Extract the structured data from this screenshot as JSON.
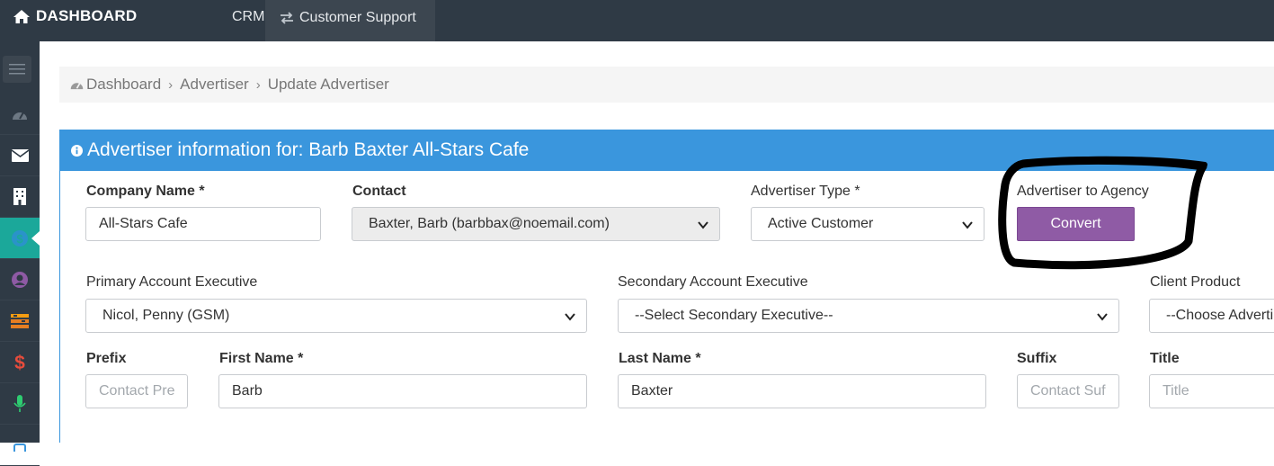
{
  "topbar": {
    "brand": "DASHBOARD",
    "nav_crm": "CRM",
    "nav_support": "Customer Support"
  },
  "sidebar": {
    "items": [
      "toggle-menu",
      "dashboard",
      "mail",
      "building",
      "dollar-circle",
      "user",
      "stack",
      "dollar",
      "microphone"
    ]
  },
  "breadcrumb": {
    "items": [
      "Dashboard",
      "Advertiser",
      "Update Advertiser"
    ]
  },
  "panel": {
    "title": "Advertiser information for: Barb Baxter All-Stars Cafe"
  },
  "form": {
    "company_name": {
      "label": "Company Name *",
      "value": "All-Stars Cafe"
    },
    "contact": {
      "label": "Contact",
      "value": "Baxter, Barb (barbbax@noemail.com)"
    },
    "advertiser_type": {
      "label": "Advertiser Type *",
      "value": "Active Customer"
    },
    "advertiser_to_agency": {
      "label": "Advertiser to Agency",
      "button": "Convert"
    },
    "primary_ae": {
      "label": "Primary Account Executive",
      "value": "Nicol, Penny (GSM)"
    },
    "secondary_ae": {
      "label": "Secondary Account Executive",
      "value": "--Select Secondary Executive--"
    },
    "client_product": {
      "label": "Client Product",
      "value": "--Choose Adverti"
    },
    "prefix": {
      "label": "Prefix",
      "placeholder": "Contact Pre"
    },
    "first_name": {
      "label": "First Name *",
      "value": "Barb"
    },
    "last_name": {
      "label": "Last Name *",
      "value": "Baxter"
    },
    "suffix": {
      "label": "Suffix",
      "placeholder": "Contact Suf"
    },
    "title": {
      "label": "Title",
      "placeholder": "Title"
    }
  },
  "colors": {
    "topbar": "#2f3a45",
    "panel_header": "#3a96dd",
    "convert_button": "#8f5ba5",
    "sidebar_active": "#1ba89a"
  }
}
